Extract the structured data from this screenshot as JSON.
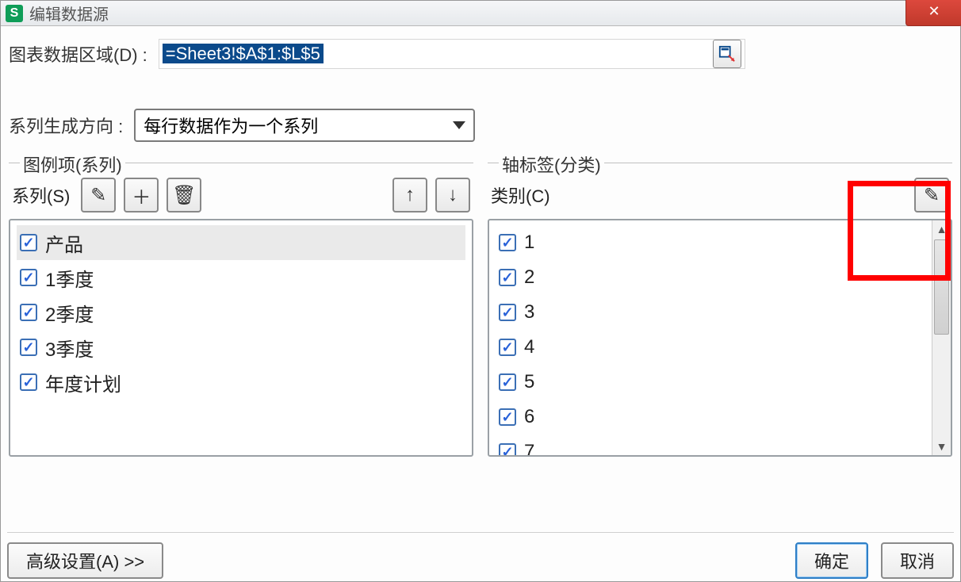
{
  "title": "编辑数据源",
  "app_icon_letter": "S",
  "close_symbol": "✕",
  "range_label": "图表数据区域(D) :",
  "range_value": "=Sheet3!$A$1:$L$5",
  "direction_label": "系列生成方向 :",
  "direction_value": "每行数据作为一个系列",
  "legend_group_title": "图例项(系列)",
  "category_group_title": "轴标签(分类)",
  "series_label": "系列(S)",
  "category_label": "类别(C)",
  "series_items": [
    {
      "label": "产品",
      "checked": true,
      "selected": true
    },
    {
      "label": "1季度",
      "checked": true
    },
    {
      "label": "2季度",
      "checked": true
    },
    {
      "label": "3季度",
      "checked": true
    },
    {
      "label": "年度计划",
      "checked": true
    }
  ],
  "category_items": [
    {
      "label": "1",
      "checked": true
    },
    {
      "label": "2",
      "checked": true
    },
    {
      "label": "3",
      "checked": true
    },
    {
      "label": "4",
      "checked": true
    },
    {
      "label": "5",
      "checked": true
    },
    {
      "label": "6",
      "checked": true
    },
    {
      "label": "7",
      "checked": true
    }
  ],
  "advanced_button": "高级设置(A) >>",
  "ok_button": "确定",
  "cancel_button": "取消",
  "icons": {
    "edit": "✎",
    "add": "＋",
    "delete": "🗑",
    "up": "↑",
    "down": "↓"
  }
}
